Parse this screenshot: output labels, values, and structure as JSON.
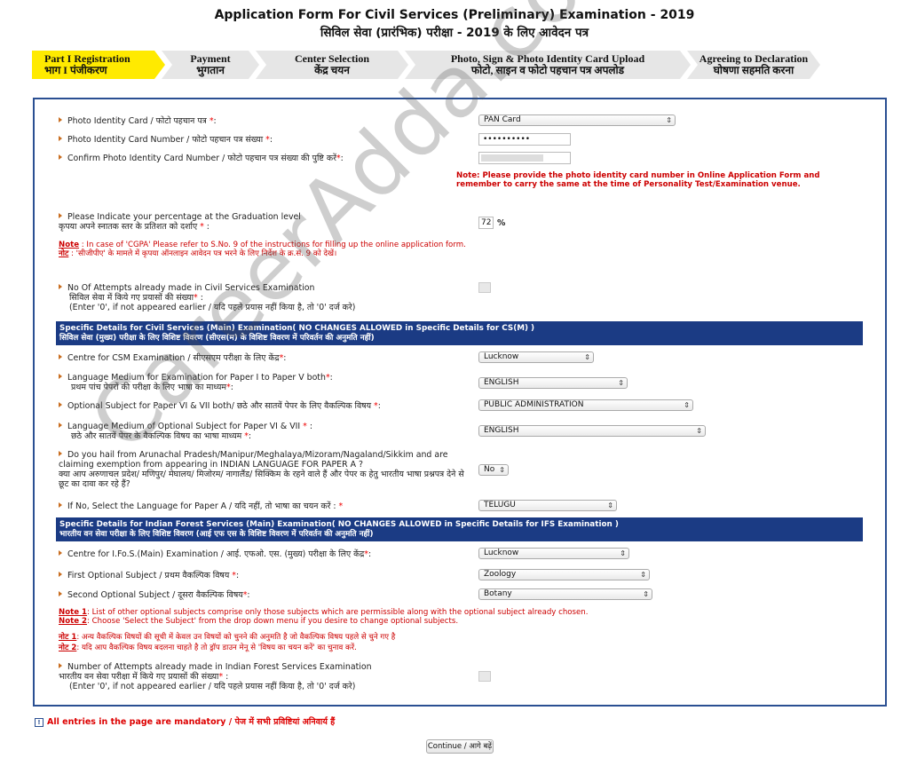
{
  "header": {
    "title_en": "Application Form For Civil Services (Preliminary) Examination - 2019",
    "title_hi": "सिविल सेवा (प्रारंभिक) परीक्षा  -  2019 के लिए आवेदन पत्र"
  },
  "steps": [
    {
      "en": "Part I Registration",
      "hi": "भाग I पंजीकरण",
      "active": true
    },
    {
      "en": "Payment",
      "hi": "भुगतान"
    },
    {
      "en": "Center Selection",
      "hi": "केंद्र चयन"
    },
    {
      "en": "Photo, Sign & Photo Identity Card Upload",
      "hi": "फोटो, साइन व फोटो पहचान पत्र अपलोड"
    },
    {
      "en": "Agreeing to Declaration",
      "hi": "घोषणा सहमति करना"
    }
  ],
  "fields": {
    "photo_id": {
      "label": "Photo Identity Card / फोटो पहचान पत्र ",
      "value": "PAN Card"
    },
    "photo_id_number": {
      "label": "Photo Identity Card Number / फोटो पहचान पत्र संख्या ",
      "value": "••••••••••"
    },
    "confirm_photo_id": {
      "label": "Confirm Photo Identity Card Number / फोटो पहचान पत्र संख्या की पुष्टि करें"
    },
    "photo_id_note": "Note: Please provide the photo identity card number in Online Application Form and remember to carry the same at the time of Personality Test/Examination venue.",
    "graduation_pct": {
      "label_en": "Please Indicate your percentage at the Graduation level",
      "label_hi": "कृपया अपने स्नातक स्तर के प्रतिशत को दर्शाए ",
      "value": "72",
      "unit": "%"
    },
    "cgpa_note_label": "Note",
    "cgpa_note_en": " : In case of 'CGPA' Please refer to S.No. 9 of the instructions for filling up the online application form.",
    "cgpa_note_hi_label": "नोट",
    "cgpa_note_hi": " : 'सीजीपीए' के मामले में कृपया ऑनलाइन आवेदन पत्र भरने के लिए निर्देश के क्र.सं. 9 को देखें।",
    "attempts_cse": {
      "label_en": "No Of Attempts already made in Civil Services Examination",
      "label_hi": "सिविल सेवा में किये गए प्रयासों की संख्या",
      "hint": "(Enter '0', if not appeared earlier / यदि पहले प्रयास नहीं किया है, तो '0' दर्ज करे)"
    }
  },
  "csm_section": {
    "title_en": "Specific Details for Civil Services (Main) Examination( NO CHANGES ALLOWED in Specific Details for CS(M) )",
    "title_hi": "सिविल सेवा (मुख्य) परीक्षा के लिए विशिष्ट विवरण (सीएस(म) के विशिष्ट विवरण में परिवर्तन की अनुमति नहीं)",
    "centre": {
      "label": "Centre for CSM Examination / सीएसएम परीक्षा के लिए केंद्र",
      "value": "Lucknow"
    },
    "medium": {
      "label_en": "Language Medium for Examination for Paper I to Paper V both",
      "label_hi": "प्रथम पांच पेपरों की परीक्षा के लिए भाषा का माध्यम",
      "value": "ENGLISH"
    },
    "optional": {
      "label": "Optional Subject for Paper VI & VII both/ छठे और सातवें पेपर के लिए वैकल्पिक विषय ",
      "value": "PUBLIC ADMINISTRATION"
    },
    "optional_medium": {
      "label_en": "Language Medium of Optional Subject for Paper VI & VII ",
      "label_hi": "छठे और सातवें पेपर के वैकल्पिक विषय का भाषा माध्यम ",
      "value": "ENGLISH"
    },
    "ne_state": {
      "label_en": "Do you hail from Arunachal Pradesh/Manipur/Meghalaya/Mizoram/Nagaland/Sikkim and are claiming exemption from appearing in INDIAN LANGUAGE FOR PAPER A ?",
      "label_hi": "क्या आप अरुणाचल प्रदेश/ मणिपुर/ मेघालय/ मिजोरम/ नागालैंड/ सिक्किम के रहने वाले हैं और पेपर क हेतु भारतीय भाषा प्रश्नपत्र देने से छूट का दावा कर रहे हैं?",
      "value": "No"
    },
    "paper_a": {
      "label": "If No, Select the Language for Paper A / यदि नहीं, तो भाषा का चयन करें : ",
      "value": "TELUGU"
    }
  },
  "ifs_section": {
    "title_en": "Specific Details for Indian Forest Services (Main) Examination( NO CHANGES ALLOWED in Specific Details for IFS Examination )",
    "title_hi": "भारतीय वन सेवा परीक्षा के लिए विशिष्ट विवरण (आई एफ एस के विशिष्ट विवरण में परिवर्तन की अनुमति नहीं)",
    "centre": {
      "label": "Centre for I.Fo.S.(Main) Examination / आई. एफओ. एस. (मुख्य) परीक्षा के लिए केंद्र",
      "value": "Lucknow"
    },
    "first_optional": {
      "label": "First Optional Subject / प्रथम वैकल्पिक विषय ",
      "value": "Zoology"
    },
    "second_optional": {
      "label": "Second Optional Subject / दूसरा वैकल्पिक विषय",
      "value": "Botany"
    },
    "note1_label": "Note 1",
    "note1": ": List of other optional subjects comprise only those subjects which are permissible along with the optional subject already chosen.",
    "note2_label": "Note 2",
    "note2": ": Choose 'Select the Subject' from the drop down menu if you desire to change optional subjects.",
    "note1_hi_label": "नोट 1",
    "note1_hi": ": अन्य वैकल्पिक विषयों की सूची में केवल उन विषयों को चुनने की अनुमति है जो वैकल्पिक विषय पहले से चुने गए है",
    "note2_hi_label": "नोट 2",
    "note2_hi": ": यदि आप वैकल्पिक विषय बदलना चाहते है तो ड्रॉप डाउन मेनू से 'विषय का चयन करें' का चुनाव करें.",
    "attempts": {
      "label_en": "Number of Attempts already made in Indian Forest Services Examination",
      "label_hi": "भारतीय वन सेवा परीक्षा में किये गए प्रयासों की संख्या",
      "hint": "(Enter '0', if not appeared earlier / यदि पहले प्रयास नहीं किया है, तो '0' दर्ज करे)"
    }
  },
  "footer": {
    "mandatory": "All entries in the page are mandatory / पेज में सभी प्रविष्टियां अनिवार्य हैं",
    "continue": "Continue / आगे बढ़ें"
  },
  "watermark": "CareerAdda.com",
  "colors": {
    "section_bar": "#1b3b84",
    "active_step": "#ffea00",
    "required": "#e00000",
    "bullet": "#c96d1f",
    "border": "#2a4f92"
  }
}
